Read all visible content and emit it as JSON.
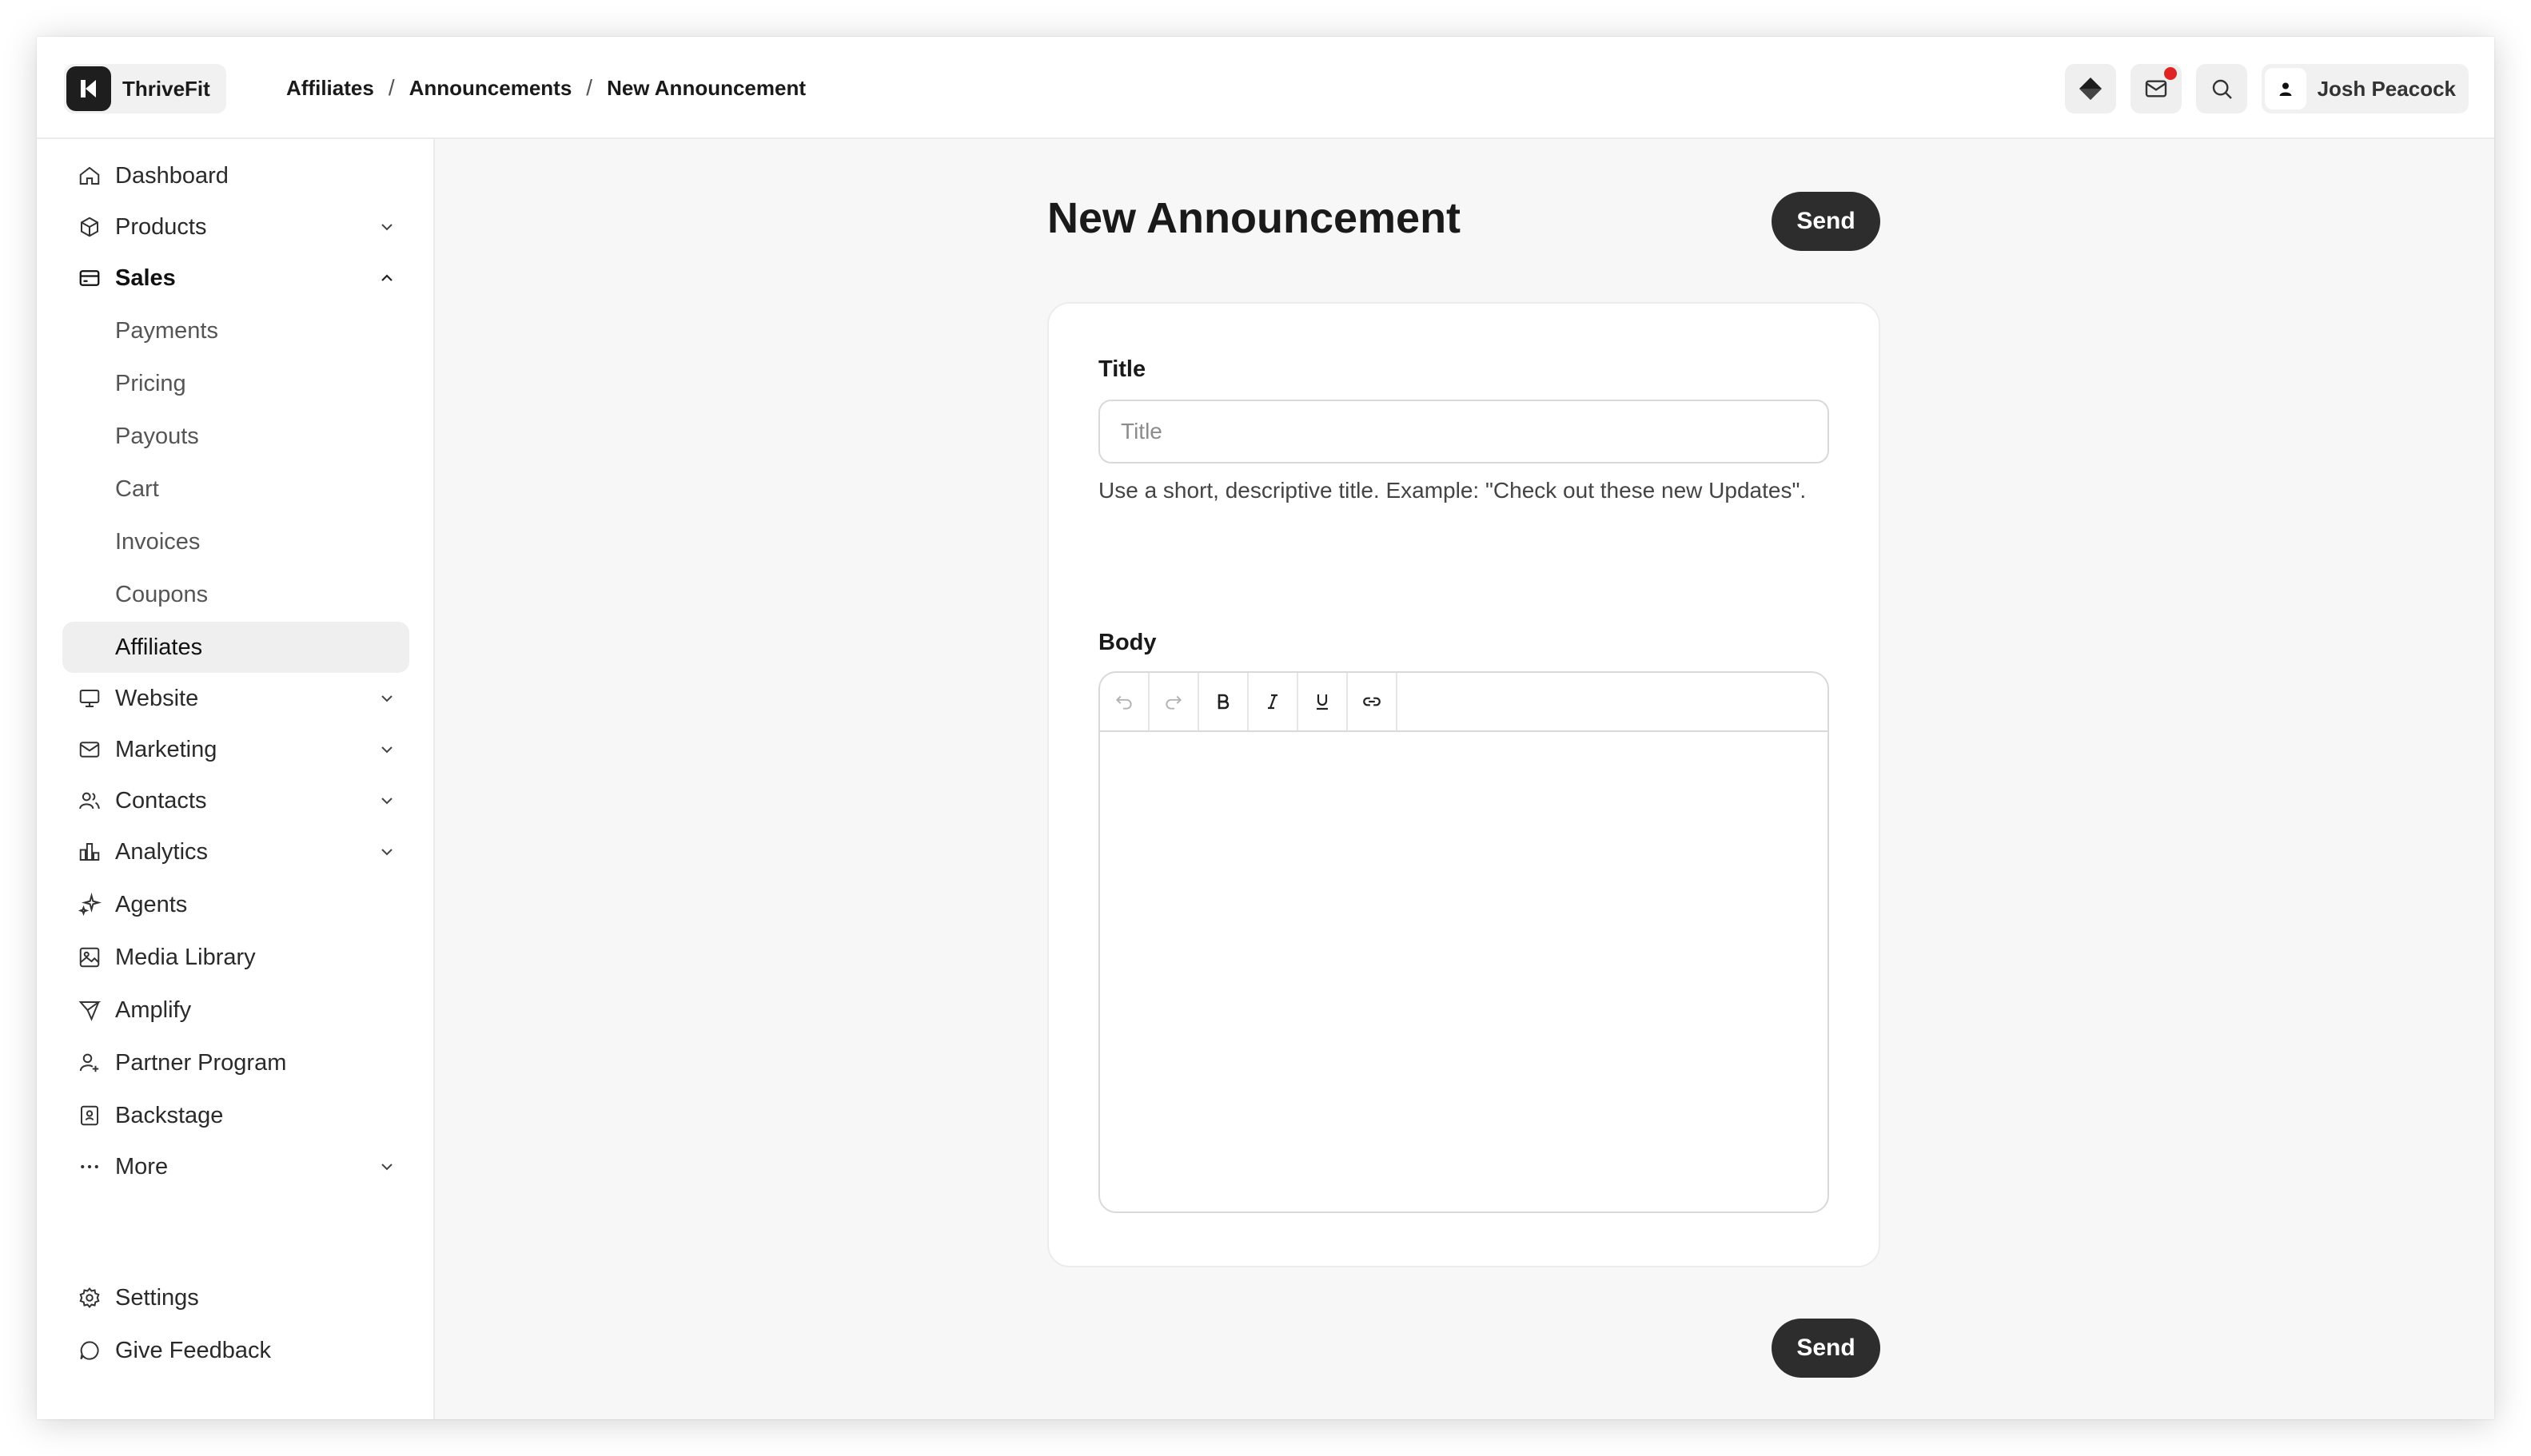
{
  "brand": {
    "name": "ThriveFit"
  },
  "breadcrumb": [
    "Affiliates",
    "Announcements",
    "New Announcement"
  ],
  "user": {
    "name": "Josh Peacock"
  },
  "sidebar": {
    "items": [
      {
        "label": "Dashboard",
        "icon": "home-icon"
      },
      {
        "label": "Products",
        "icon": "box-icon",
        "expandable": true
      },
      {
        "label": "Sales",
        "icon": "credit-card-icon",
        "expanded": true
      },
      {
        "label": "Website",
        "icon": "monitor-icon",
        "expandable": true
      },
      {
        "label": "Marketing",
        "icon": "mail-icon",
        "expandable": true
      },
      {
        "label": "Contacts",
        "icon": "users-icon",
        "expandable": true
      },
      {
        "label": "Analytics",
        "icon": "bar-chart-icon",
        "expandable": true
      },
      {
        "label": "Agents",
        "icon": "sparkles-icon"
      },
      {
        "label": "Media Library",
        "icon": "image-icon"
      },
      {
        "label": "Amplify",
        "icon": "send-icon"
      },
      {
        "label": "Partner Program",
        "icon": "user-plus-icon"
      },
      {
        "label": "Backstage",
        "icon": "badge-icon"
      },
      {
        "label": "More",
        "icon": "more-icon",
        "expandable": true
      }
    ],
    "sales_sub": [
      "Payments",
      "Pricing",
      "Payouts",
      "Cart",
      "Invoices",
      "Coupons",
      "Affiliates"
    ],
    "active_sub": "Affiliates",
    "footer": [
      {
        "label": "Settings",
        "icon": "gear-icon"
      },
      {
        "label": "Give Feedback",
        "icon": "chat-icon"
      }
    ]
  },
  "main": {
    "title": "New Announcement",
    "send_label": "Send",
    "form": {
      "title_label": "Title",
      "title_placeholder": "Title",
      "title_value": "",
      "title_help": "Use a short, descriptive title. Example: \"Check out these new Updates\".",
      "body_label": "Body",
      "toolbar": [
        "undo-icon",
        "redo-icon",
        "bold-icon",
        "italic-icon",
        "underline-icon",
        "link-icon"
      ]
    }
  },
  "colors": {
    "primary_button": "#2d2d2d",
    "notification": "#e02424",
    "active_nav_bg": "#efefef"
  }
}
